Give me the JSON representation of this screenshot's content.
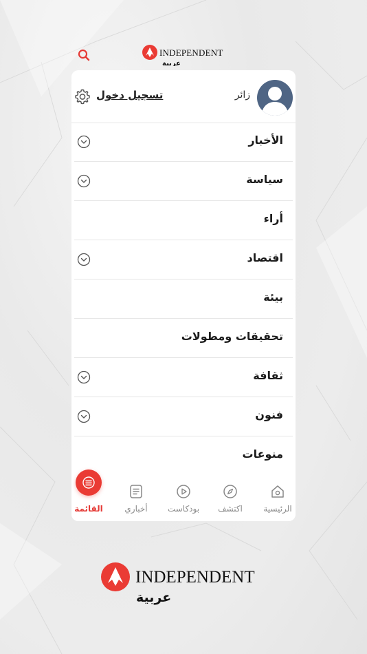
{
  "brand": {
    "name": "INDEPENDENT",
    "sub": "عربية",
    "accent": "#ea3b34"
  },
  "header": {
    "search_icon": "search-icon"
  },
  "profile": {
    "visitor": "زائر",
    "login": "تسجيل دخول",
    "settings_icon": "gear-icon"
  },
  "menu": {
    "items": [
      {
        "label": "الأخبار",
        "expandable": true
      },
      {
        "label": "سياسة",
        "expandable": true
      },
      {
        "label": "أراء",
        "expandable": false
      },
      {
        "label": "اقتصاد",
        "expandable": true
      },
      {
        "label": "بيئة",
        "expandable": false
      },
      {
        "label": "تحقيقات ومطولات",
        "expandable": false
      },
      {
        "label": "ثقافة",
        "expandable": true
      },
      {
        "label": "فنون",
        "expandable": true
      },
      {
        "label": "منوعات",
        "expandable": false
      }
    ]
  },
  "bottom_nav": {
    "menu": "القائمة",
    "my_news": "أخباري",
    "podcast": "بودكاست",
    "discover": "اكتشف",
    "home": "الرئيسية"
  }
}
